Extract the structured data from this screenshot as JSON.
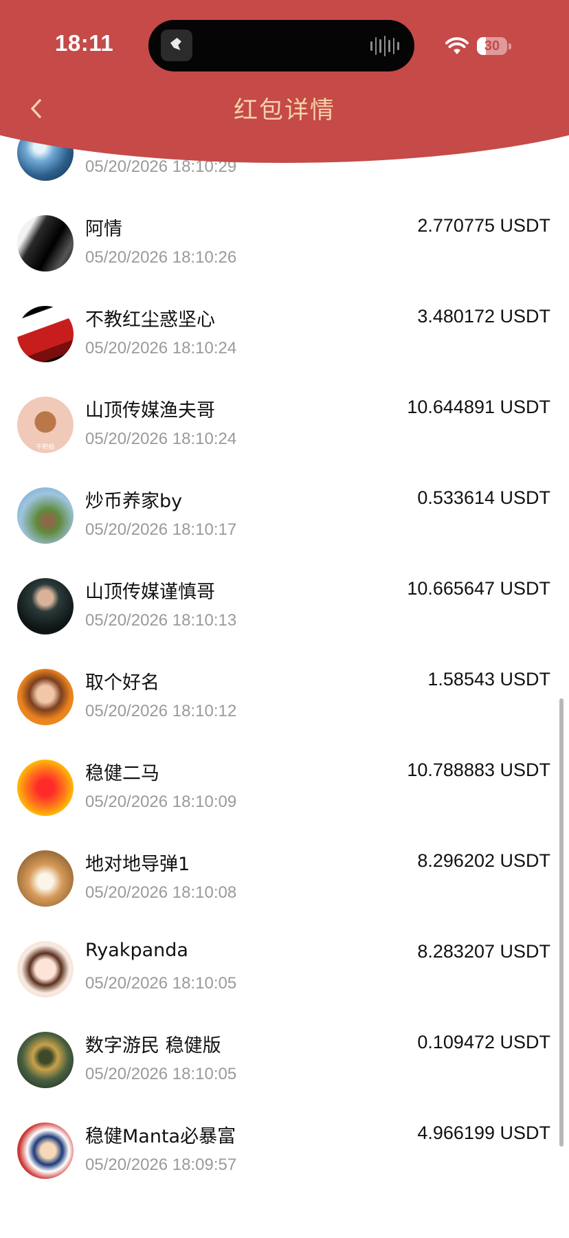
{
  "status_bar": {
    "time": "18:11",
    "battery": "30",
    "battery_level": 0.3,
    "wifi_icon": "wifi-icon"
  },
  "header": {
    "title": "红包详情",
    "back_icon": "chevron-left-icon",
    "background_color": "#c54a48",
    "title_color": "#f6d2a8"
  },
  "claims": [
    {
      "name": "",
      "amount": "",
      "time": "05/20/2026 18:10:29",
      "avatar": "anime-character-avatar"
    },
    {
      "name": "阿情",
      "amount": "2.770775 USDT",
      "time": "05/20/2026 18:10:26",
      "avatar": "dark-silhouette-avatar"
    },
    {
      "name": "不教红尘惑坚心",
      "amount": "3.480172 USDT",
      "time": "05/20/2026 18:10:24",
      "avatar": "red-sketch-avatar"
    },
    {
      "name": "山顶传媒渔夫哥",
      "amount": "10.644891 USDT",
      "time": "05/20/2026 18:10:24",
      "avatar": "cartoon-mouse-avatar",
      "avatar_caption": "干积极"
    },
    {
      "name": "炒币养家by",
      "amount": "0.533614 USDT",
      "time": "05/20/2026 18:10:17",
      "avatar": "tree-avatar"
    },
    {
      "name": "山顶传媒谨慎哥",
      "amount": "10.665647 USDT",
      "time": "05/20/2026 18:10:13",
      "avatar": "man-in-suit-avatar"
    },
    {
      "name": "取个好名",
      "amount": "1.58543 USDT",
      "time": "05/20/2026 18:10:12",
      "avatar": "woman-portrait-avatar"
    },
    {
      "name": "稳健二马",
      "amount": "10.788883 USDT",
      "time": "05/20/2026 18:10:09",
      "avatar": "gradient-circle-avatar"
    },
    {
      "name": "地对地导弹1",
      "amount": "8.296202 USDT",
      "time": "05/20/2026 18:10:08",
      "avatar": "cat-avatar"
    },
    {
      "name": "Ryakpanda",
      "amount": "8.283207 USDT",
      "time": "05/20/2026 18:10:05",
      "avatar": "princess-cartoon-avatar"
    },
    {
      "name": "数字游民 稳健版",
      "amount": "0.109472 USDT",
      "time": "05/20/2026 18:10:05",
      "avatar": "meditating-figure-avatar"
    },
    {
      "name": "稳健Manta必暴富",
      "amount": "4.966199 USDT",
      "time": "05/20/2026 18:09:57",
      "avatar": "cartoon-man-flag-avatar"
    }
  ]
}
